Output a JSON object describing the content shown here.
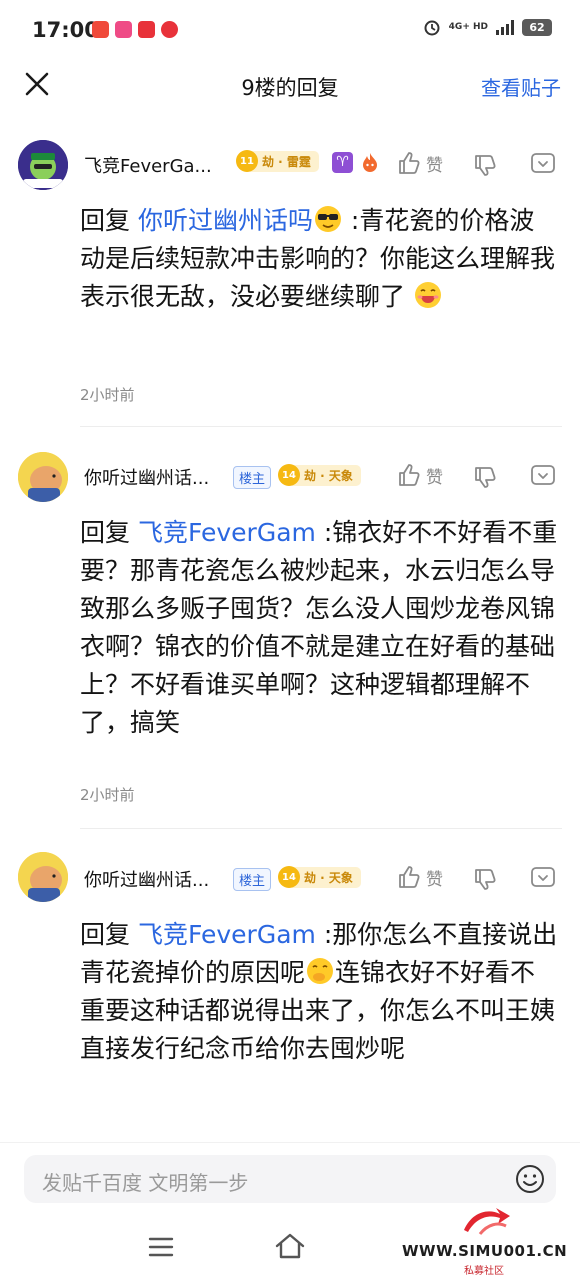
{
  "status_bar": {
    "time": "17:00",
    "network": "4G+ HD",
    "battery": "62"
  },
  "header": {
    "title": "9楼的回复",
    "view_post": "查看贴子"
  },
  "replies": [
    {
      "username": "飞竞FeverGa...",
      "level": "11",
      "level_title": "劫 · 雷霆",
      "zodiac": "♈",
      "like_label": "赞",
      "reply_prefix": "回复",
      "mention": "你听过幽州话吗",
      "text_after_emoji": " :青花瓷的价格波动是后续短款冲击影响的？你能这么理解我表示很无敌，没必要继续聊了",
      "time": "2小时前"
    },
    {
      "username": "你听过幽州话...",
      "owner_tag": "楼主",
      "level": "14",
      "level_title": "劫 · 天象",
      "like_label": "赞",
      "reply_prefix": "回复",
      "mention": "飞竞FeverGam",
      "text": " :锦衣好不不好看不重要？那青花瓷怎么被炒起来，水云归怎么导致那么多贩子囤货？怎么没人囤炒龙卷风锦衣啊？锦衣的价值不就是建立在好看的基础上？不好看谁买单啊？这种逻辑都理解不了，搞笑",
      "time": "2小时前"
    },
    {
      "username": "你听过幽州话...",
      "owner_tag": "楼主",
      "level": "14",
      "level_title": "劫 · 天象",
      "like_label": "赞",
      "reply_prefix": "回复",
      "mention": "飞竞FeverGam",
      "text_before_emoji": " :那你怎么不直接说出青花瓷掉价的原因呢",
      "text_after_emoji": "连锦衣好不好看不重要这种话都说得出来了，你怎么不叫王姨直接发行纪念币给你去囤炒呢"
    }
  ],
  "input": {
    "placeholder": "发贴千百度 文明第一步"
  },
  "watermark": {
    "text": "WWW.SIMU001.CN",
    "sub": "私募社区"
  },
  "colors": {
    "accent": "#2b67e0",
    "level_gold": "#f6b912",
    "owner_tag": "#2e66d9"
  }
}
